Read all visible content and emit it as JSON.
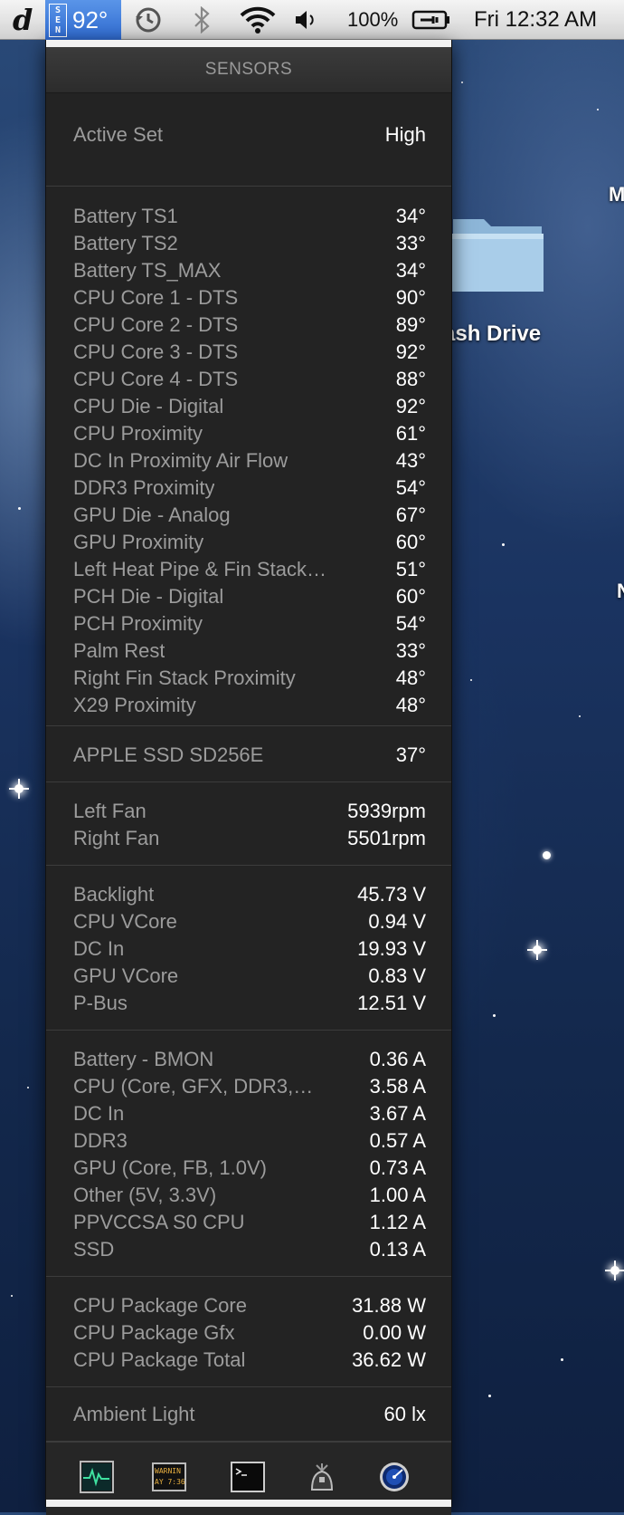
{
  "menubar": {
    "logo": "d",
    "sensor_extra": {
      "stack_lines": [
        "S",
        "E",
        "N"
      ],
      "temp": "92°"
    },
    "battery_percent": "100%",
    "clock": "Fri 12:32 AM",
    "icons": [
      "time-machine-icon",
      "bluetooth-icon",
      "wifi-icon",
      "volume-icon",
      "battery-icon"
    ]
  },
  "panel": {
    "title": "SENSORS",
    "active_set": {
      "label": "Active Set",
      "value": "High"
    },
    "temperatures": [
      {
        "label": "Battery TS1",
        "value": "34°"
      },
      {
        "label": "Battery TS2",
        "value": "33°"
      },
      {
        "label": "Battery TS_MAX",
        "value": "34°"
      },
      {
        "label": "CPU Core 1 - DTS",
        "value": "90°"
      },
      {
        "label": "CPU Core 2 - DTS",
        "value": "89°"
      },
      {
        "label": "CPU Core 3 - DTS",
        "value": "92°"
      },
      {
        "label": "CPU Core 4 - DTS",
        "value": "88°"
      },
      {
        "label": "CPU Die - Digital",
        "value": "92°"
      },
      {
        "label": "CPU Proximity",
        "value": "61°"
      },
      {
        "label": "DC In Proximity Air Flow",
        "value": "43°"
      },
      {
        "label": "DDR3 Proximity",
        "value": "54°"
      },
      {
        "label": "GPU Die - Analog",
        "value": "67°"
      },
      {
        "label": "GPU Proximity",
        "value": "60°"
      },
      {
        "label": "Left Heat Pipe & Fin Stack…",
        "value": "51°"
      },
      {
        "label": "PCH Die - Digital",
        "value": "60°"
      },
      {
        "label": "PCH Proximity",
        "value": "54°"
      },
      {
        "label": "Palm Rest",
        "value": "33°"
      },
      {
        "label": "Right Fin Stack Proximity",
        "value": "48°"
      },
      {
        "label": "X29 Proximity",
        "value": "48°"
      }
    ],
    "drives": [
      {
        "label": "APPLE SSD SD256E",
        "value": "37°"
      }
    ],
    "fans": [
      {
        "label": "Left Fan",
        "value": "5939rpm"
      },
      {
        "label": "Right Fan",
        "value": "5501rpm"
      }
    ],
    "voltages": [
      {
        "label": "Backlight",
        "value": "45.73 V"
      },
      {
        "label": "CPU VCore",
        "value": "0.94 V"
      },
      {
        "label": "DC In",
        "value": "19.93 V"
      },
      {
        "label": "GPU VCore",
        "value": "0.83 V"
      },
      {
        "label": "P-Bus",
        "value": "12.51 V"
      }
    ],
    "currents": [
      {
        "label": "Battery - BMON",
        "value": "0.36 A"
      },
      {
        "label": "CPU (Core, GFX, DDR3,…",
        "value": "3.58 A"
      },
      {
        "label": "DC In",
        "value": "3.67 A"
      },
      {
        "label": "DDR3",
        "value": "0.57 A"
      },
      {
        "label": "GPU (Core, FB, 1.0V)",
        "value": "0.73 A"
      },
      {
        "label": "Other (5V, 3.3V)",
        "value": "1.00 A"
      },
      {
        "label": "PPVCCSA S0 CPU",
        "value": "1.12 A"
      },
      {
        "label": "SSD",
        "value": "0.13 A"
      }
    ],
    "power": [
      {
        "label": "CPU Package Core",
        "value": "31.88 W"
      },
      {
        "label": "CPU Package Gfx",
        "value": "0.00 W"
      },
      {
        "label": "CPU Package Total",
        "value": "36.62 W"
      }
    ],
    "light": [
      {
        "label": "Ambient Light",
        "value": "60 lx"
      }
    ],
    "toolbar": {
      "console_text_lines": [
        "WARNIN",
        "AY 7:36"
      ],
      "tools": [
        "activity-monitor-icon",
        "console-icon",
        "terminal-icon",
        "system-information-icon",
        "disk-utility-icon"
      ]
    }
  },
  "desktop": {
    "folder_label": "ash Drive",
    "edge_letter_1": "M",
    "edge_letter_2": "N"
  }
}
